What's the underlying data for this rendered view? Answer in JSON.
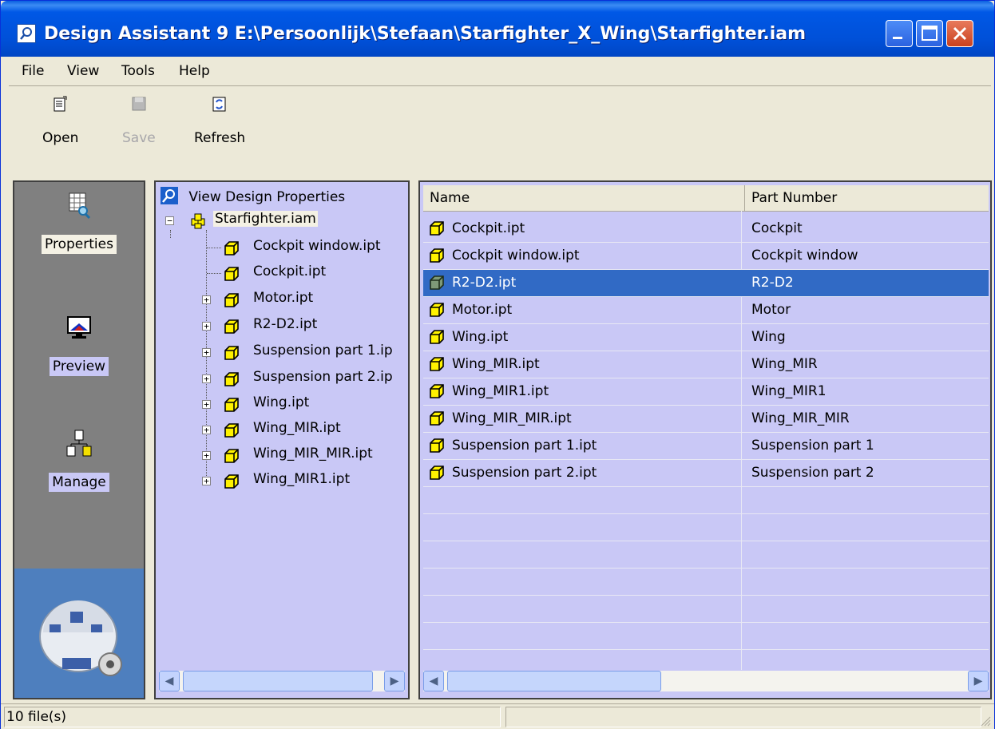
{
  "window": {
    "title": "Design Assistant 9 E:\\Persoonlijk\\Stefaan\\Starfighter_X_Wing\\Starfighter.iam"
  },
  "menu": {
    "items": [
      {
        "label": "File"
      },
      {
        "label": "View"
      },
      {
        "label": "Tools"
      },
      {
        "label": "Help"
      }
    ]
  },
  "toolbar": {
    "open_label": "Open",
    "save_label": "Save",
    "refresh_label": "Refresh"
  },
  "leftnav": {
    "items": [
      {
        "label": "Properties",
        "icon": "properties-icon",
        "selected": true
      },
      {
        "label": "Preview",
        "icon": "preview-icon"
      },
      {
        "label": "Manage",
        "icon": "manage-icon"
      }
    ]
  },
  "tree": {
    "header": "View Design Properties",
    "root": "Starfighter.iam",
    "children": [
      {
        "label": "Cockpit window.ipt",
        "expandable": false
      },
      {
        "label": "Cockpit.ipt",
        "expandable": false
      },
      {
        "label": "Motor.ipt",
        "expandable": true
      },
      {
        "label": "R2-D2.ipt",
        "expandable": true
      },
      {
        "label": "Suspension part 1.ip",
        "expandable": true
      },
      {
        "label": "Suspension part 2.ip",
        "expandable": true
      },
      {
        "label": "Wing.ipt",
        "expandable": true
      },
      {
        "label": "Wing_MIR.ipt",
        "expandable": true
      },
      {
        "label": "Wing_MIR_MIR.ipt",
        "expandable": true
      },
      {
        "label": "Wing_MIR1.ipt",
        "expandable": true
      }
    ]
  },
  "list": {
    "columns": [
      "Name",
      "Part Number"
    ],
    "rows": [
      {
        "name": "Cockpit.ipt",
        "part_number": "Cockpit"
      },
      {
        "name": "Cockpit window.ipt",
        "part_number": "Cockpit window"
      },
      {
        "name": "R2-D2.ipt",
        "part_number": "R2-D2",
        "selected": true
      },
      {
        "name": "Motor.ipt",
        "part_number": "Motor"
      },
      {
        "name": "Wing.ipt",
        "part_number": "Wing"
      },
      {
        "name": "Wing_MIR.ipt",
        "part_number": "Wing_MIR"
      },
      {
        "name": "Wing_MIR1.ipt",
        "part_number": "Wing_MIR1"
      },
      {
        "name": "Wing_MIR_MIR.ipt",
        "part_number": "Wing_MIR_MIR"
      },
      {
        "name": "Suspension part 1.ipt",
        "part_number": "Suspension part 1"
      },
      {
        "name": "Suspension part 2.ipt",
        "part_number": "Suspension part 2"
      }
    ]
  },
  "status": {
    "files": "10 file(s)"
  },
  "colors": {
    "panel_bg": "#C9C8F6",
    "selection": "#316AC5",
    "titlebar": "#0058E6"
  }
}
